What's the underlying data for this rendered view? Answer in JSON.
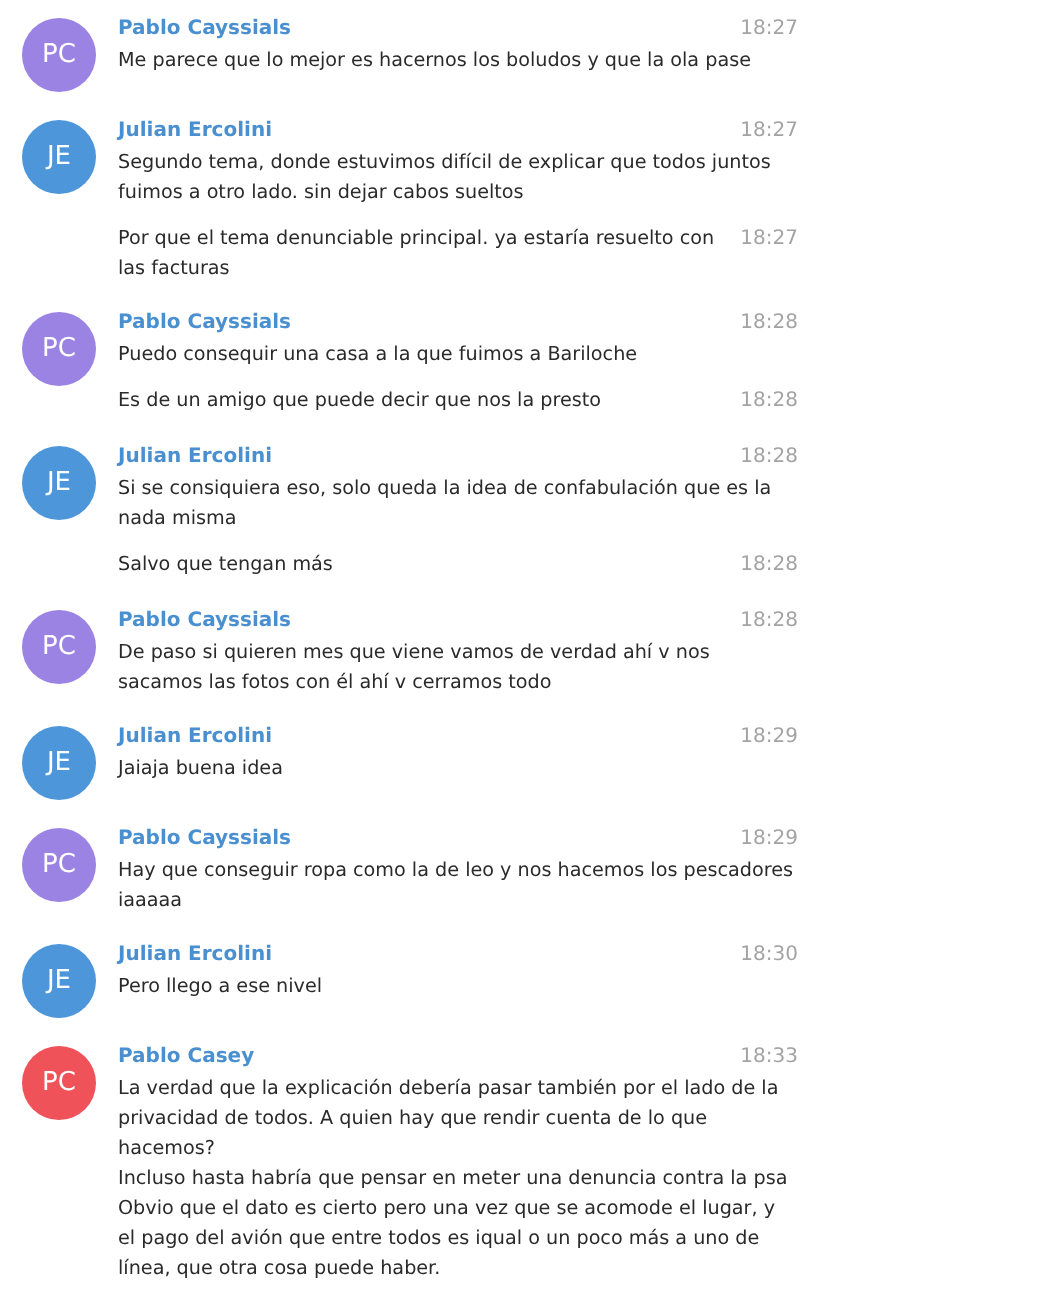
{
  "groups": [
    {
      "sender": "Pablo Cayssials",
      "initials": "PC",
      "color": "#9b83e3",
      "messages": [
        {
          "text": "Me parece que lo mejor es hacernos los boludos y que la ola pase",
          "time": "18:27"
        }
      ]
    },
    {
      "sender": "Julian Ercolini",
      "initials": "JE",
      "color": "#4d96d9",
      "messages": [
        {
          "text": "Segundo tema, donde estuvimos difícil de explicar que todos juntos fuimos a otro lado. sin dejar cabos sueltos",
          "time": "18:27"
        },
        {
          "text": "Por que el tema denunciable principal. ya estaría resuelto con las facturas",
          "time": "18:27"
        }
      ]
    },
    {
      "sender": "Pablo Cayssials",
      "initials": "PC",
      "color": "#9b83e3",
      "messages": [
        {
          "text": "Puedo consequir una casa a la que fuimos a Bariloche",
          "time": "18:28"
        },
        {
          "text": "Es de un amigo que puede decir que nos la presto",
          "time": "18:28"
        }
      ]
    },
    {
      "sender": "Julian Ercolini",
      "initials": "JE",
      "color": "#4d96d9",
      "messages": [
        {
          "text": "Si se consiquiera eso, solo queda la idea de confabulación que es la nada misma",
          "time": "18:28"
        },
        {
          "text": "Salvo que tengan más",
          "time": "18:28"
        }
      ]
    },
    {
      "sender": "Pablo Cayssials",
      "initials": "PC",
      "color": "#9b83e3",
      "messages": [
        {
          "text": "De paso si quieren mes que viene vamos de verdad ahí v nos sacamos las fotos con él ahí v cerramos todo",
          "time": "18:28"
        }
      ]
    },
    {
      "sender": "Julian Ercolini",
      "initials": "JE",
      "color": "#4d96d9",
      "messages": [
        {
          "text": "Jaiaja buena idea",
          "time": "18:29"
        }
      ]
    },
    {
      "sender": "Pablo Cayssials",
      "initials": "PC",
      "color": "#9b83e3",
      "messages": [
        {
          "text": "Hay que conseguir ropa como la de leo y nos hacemos los pescadores iaaaaa",
          "time": "18:29"
        }
      ]
    },
    {
      "sender": "Julian Ercolini",
      "initials": "JE",
      "color": "#4d96d9",
      "messages": [
        {
          "text": "Pero llego a ese nivel",
          "time": "18:30"
        }
      ]
    },
    {
      "sender": "Pablo Casey",
      "initials": "PC",
      "color": "#f0525a",
      "messages": [
        {
          "text": "La verdad que la explicación debería pasar también por el lado de la privacidad de todos. A quien hay que rendir cuenta de lo que hacemos?\nIncluso hasta habría que pensar en meter una denuncia contra la psa\nObvio que el dato es cierto pero una vez que se acomode el lugar, y el pago del avión que entre todos es iqual o un poco más a uno de línea, que otra cosa puede haber.",
          "time": "18:33"
        }
      ]
    }
  ]
}
